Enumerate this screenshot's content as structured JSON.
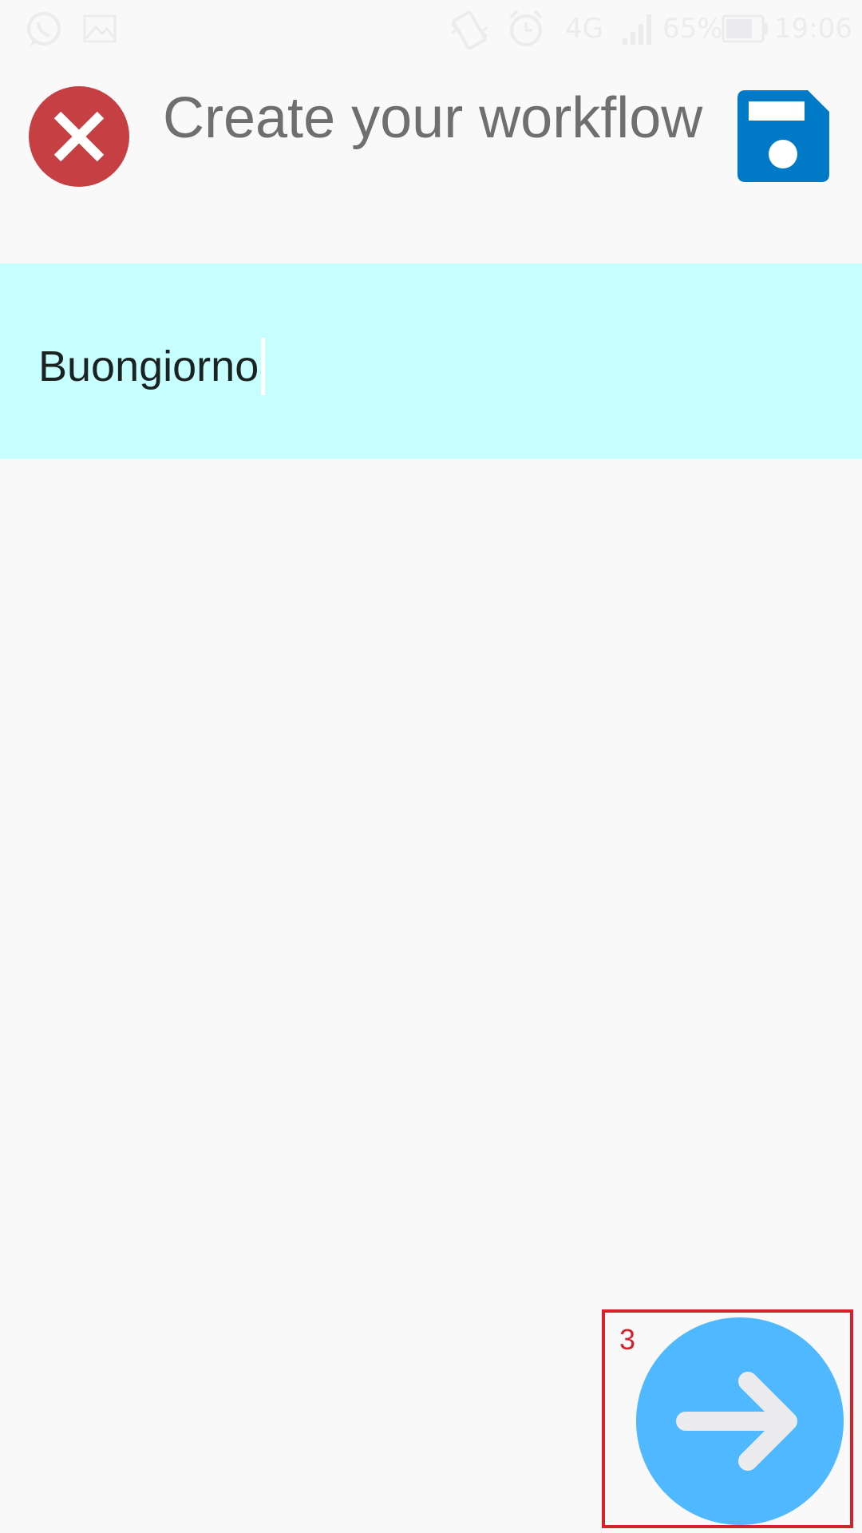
{
  "status_bar": {
    "network": "4G",
    "battery": "65%",
    "time": "19:06",
    "icons": [
      "whatsapp-icon",
      "image-icon",
      "vibrate-icon",
      "alarm-icon",
      "signal-icon",
      "battery-icon"
    ]
  },
  "header": {
    "title": "Create your workflow",
    "close_icon": "close-icon",
    "save_icon": "save-icon"
  },
  "step_input": {
    "value": "Buongiorno"
  },
  "next_button": {
    "icon": "arrow-right-icon"
  },
  "overlay": {
    "label": "3"
  },
  "colors": {
    "background": "#f9f9fa",
    "input_background": "#c6fffe",
    "close": "#c63f42",
    "save": "#007ac7",
    "next": "#4fb8fe",
    "highlight": "#d3222a",
    "title": "#6f6f6f"
  }
}
